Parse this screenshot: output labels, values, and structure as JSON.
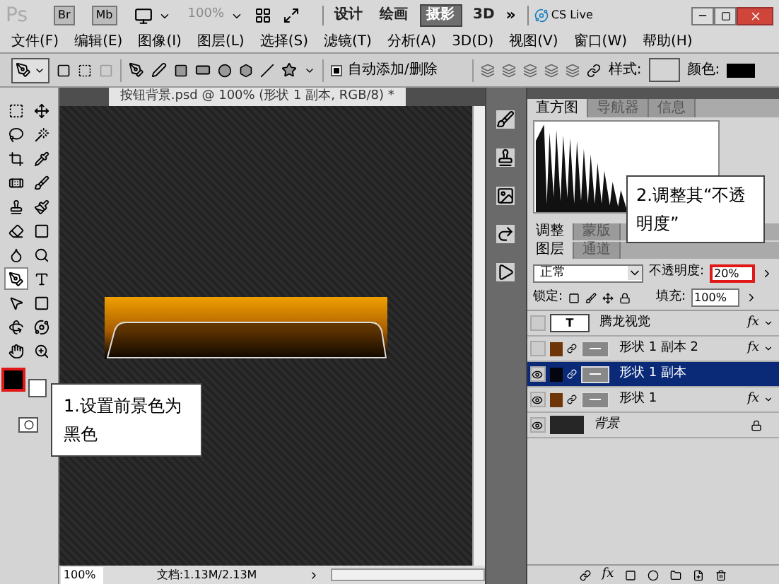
{
  "app_bar": {
    "logo": "Ps",
    "bridge_buttons": [
      "Br",
      "Mb"
    ],
    "zoom": "100%",
    "workspaces": [
      {
        "label": "设计",
        "selected": false
      },
      {
        "label": "绘画",
        "selected": false
      },
      {
        "label": "摄影",
        "selected": true
      },
      {
        "label": "3D",
        "selected": false
      }
    ],
    "more": "»",
    "cs_live": "CS Live"
  },
  "menu": [
    "文件(F)",
    "编辑(E)",
    "图像(I)",
    "图层(L)",
    "选择(S)",
    "滤镜(T)",
    "分析(A)",
    "3D(D)",
    "视图(V)",
    "窗口(W)",
    "帮助(H)"
  ],
  "options_bar": {
    "auto_add_delete": {
      "label": "自动添加/删除",
      "checked": true
    },
    "style_label": "样式:",
    "color_label": "颜色:"
  },
  "toolbox": {
    "tools": [
      {
        "selected": false
      },
      {
        "selected": false
      },
      {
        "selected": false
      },
      {
        "selected": false
      },
      {
        "selected": false
      },
      {
        "selected": false
      },
      {
        "selected": false
      },
      {
        "selected": false
      },
      {
        "selected": false
      },
      {
        "selected": false
      },
      {
        "selected": false
      },
      {
        "selected": false
      },
      {
        "selected": false
      },
      {
        "selected": false
      },
      {
        "selected": true
      },
      {
        "selected": false
      },
      {
        "selected": false
      },
      {
        "selected": false
      },
      {
        "selected": false
      },
      {
        "selected": false
      },
      {
        "selected": false
      },
      {
        "selected": false
      }
    ],
    "foreground_highlighted": true
  },
  "document": {
    "tab": "按钮背景.psd @ 100% (形状 1 副本, RGB/8) *",
    "status_zoom": "100%",
    "doc_info": "文档:1.13M/2.13M"
  },
  "histogram_panel": {
    "tabs": [
      {
        "label": "直方图",
        "selected": true
      },
      {
        "label": "导航器",
        "selected": false
      },
      {
        "label": "信息",
        "selected": false
      }
    ]
  },
  "adjustments_panel": {
    "tabs": [
      {
        "label": "调整",
        "selected": true
      },
      {
        "label": "蒙版",
        "selected": false
      }
    ]
  },
  "layers_panel": {
    "tabs": [
      {
        "label": "图层",
        "selected": true
      },
      {
        "label": "通道",
        "selected": false
      }
    ],
    "blend_mode": "正常",
    "opacity": {
      "label": "不透明度:",
      "value": "20%",
      "highlighted": true
    },
    "lock_label": "锁定:",
    "fill": {
      "label": "填充:",
      "value": "100%"
    },
    "layers": [
      {
        "name": "腾龙视觉",
        "kind": "text",
        "thumbnail_text": "T",
        "visible": false,
        "selected": false,
        "fx": "fx"
      },
      {
        "name": "形状 1 副本 2",
        "kind": "shape",
        "visible": false,
        "selected": false,
        "color": "#6e3608",
        "fx": "fx"
      },
      {
        "name": "形状 1 副本",
        "kind": "shape",
        "visible": true,
        "selected": true,
        "color": "#05050f"
      },
      {
        "name": "形状 1",
        "kind": "shape",
        "visible": true,
        "selected": false,
        "color": "#6e3608",
        "fx": "fx"
      },
      {
        "name": "背景",
        "kind": "background",
        "visible": true,
        "selected": false,
        "locked": true
      }
    ],
    "footer_fx": "fx"
  },
  "callouts": [
    {
      "text": "1.设置前景色为黑色"
    },
    {
      "text": "2.调整其“不透明度”"
    }
  ]
}
